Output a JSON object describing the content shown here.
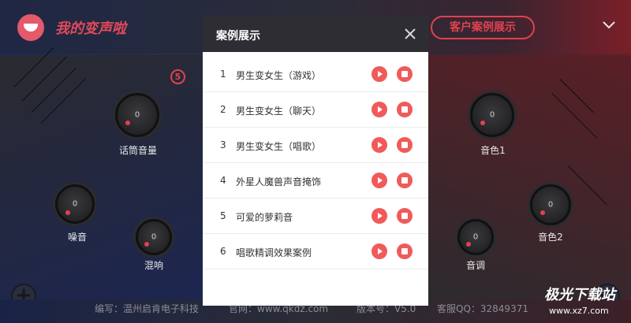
{
  "header": {
    "app_name": "我的变声啦",
    "cases_button": "客户案例展示"
  },
  "knobs": {
    "mic_volume": {
      "label": "话筒音量",
      "value": "0"
    },
    "noise": {
      "label": "噪音",
      "value": "0"
    },
    "reverb": {
      "label": "混响",
      "value": "0"
    },
    "timbre1": {
      "label": "音色1",
      "value": "0"
    },
    "timbre2": {
      "label": "音色2",
      "value": "0"
    },
    "pitch": {
      "label": "音调",
      "value": "0"
    }
  },
  "badge": "5",
  "footer": {
    "author": "编写：温州启肯电子科技",
    "website": "官网：www.qkdz.com",
    "version": "版本号：V5.0",
    "qq": "客服QQ：32849371"
  },
  "modal": {
    "title": "案例展示",
    "items": [
      {
        "num": "1",
        "name": "男生变女生（游戏）"
      },
      {
        "num": "2",
        "name": "男生变女生（聊天）"
      },
      {
        "num": "3",
        "name": "男生变女生（唱歌）"
      },
      {
        "num": "4",
        "name": "外星人魔兽声音掩饰"
      },
      {
        "num": "5",
        "name": "可爱的萝莉音"
      },
      {
        "num": "6",
        "name": "唱歌精调效果案例"
      }
    ]
  },
  "watermark": {
    "text": "极光下载站",
    "url": "www.xz7.com"
  },
  "colors": {
    "accent": "#e2414e",
    "play": "#f05a5a",
    "modal_header": "#2d2d33"
  },
  "icons": {
    "close": "close-icon",
    "menu": "chevron-down-icon",
    "play": "play-icon",
    "stop": "stop-icon"
  }
}
